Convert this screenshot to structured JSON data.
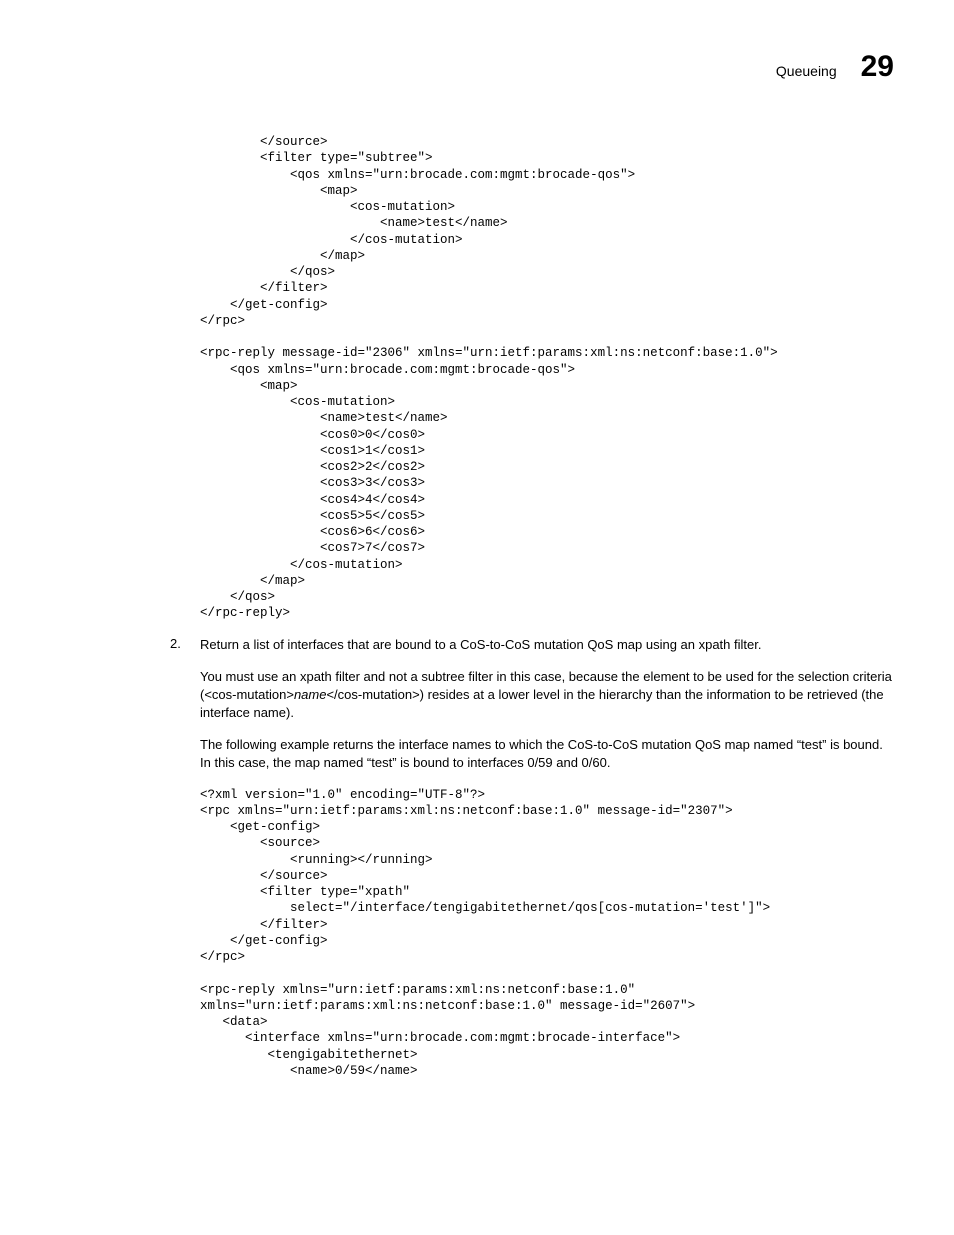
{
  "header": {
    "title": "Queueing",
    "page": "29"
  },
  "code1": "        </source>\n        <filter type=\"subtree\">\n            <qos xmlns=\"urn:brocade.com:mgmt:brocade-qos\">\n                <map>\n                    <cos-mutation>\n                        <name>test</name>\n                    </cos-mutation>\n                </map>\n            </qos>\n        </filter>\n    </get-config>\n</rpc>\n\n<rpc-reply message-id=\"2306\" xmlns=\"urn:ietf:params:xml:ns:netconf:base:1.0\">\n    <qos xmlns=\"urn:brocade.com:mgmt:brocade-qos\">\n        <map>\n            <cos-mutation>\n                <name>test</name>\n                <cos0>0</cos0>\n                <cos1>1</cos1>\n                <cos2>2</cos2>\n                <cos3>3</cos3>\n                <cos4>4</cos4>\n                <cos5>5</cos5>\n                <cos6>6</cos6>\n                <cos7>7</cos7>\n            </cos-mutation>\n        </map>\n    </qos>\n</rpc-reply>",
  "step2": {
    "num": "2.",
    "text": "Return a list of interfaces that are bound to a CoS-to-CoS mutation QoS map using an xpath filter."
  },
  "para1_a": "You must use an xpath filter and not a subtree filter in this case, because the element to be used for the selection criteria (<cos-mutation>",
  "para1_b": "name",
  "para1_c": "</cos-mutation>) resides at a lower level in the hierarchy than the information to be retrieved (the interface name).",
  "para2": "The following example returns the interface names to which the CoS-to-CoS mutation QoS map named “test” is bound. In this case, the map named “test” is bound to interfaces 0/59 and 0/60.",
  "code2": "<?xml version=\"1.0\" encoding=\"UTF-8\"?>\n<rpc xmlns=\"urn:ietf:params:xml:ns:netconf:base:1.0\" message-id=\"2307\">\n    <get-config>\n        <source>\n            <running></running>\n        </source>\n        <filter type=\"xpath\"\n            select=\"/interface/tengigabitethernet/qos[cos-mutation='test']\">\n        </filter>\n    </get-config>\n</rpc>\n\n<rpc-reply xmlns=\"urn:ietf:params:xml:ns:netconf:base:1.0\"\nxmlns=\"urn:ietf:params:xml:ns:netconf:base:1.0\" message-id=\"2607\">\n   <data>\n      <interface xmlns=\"urn:brocade.com:mgmt:brocade-interface\">\n         <tengigabitethernet>\n            <name>0/59</name>"
}
